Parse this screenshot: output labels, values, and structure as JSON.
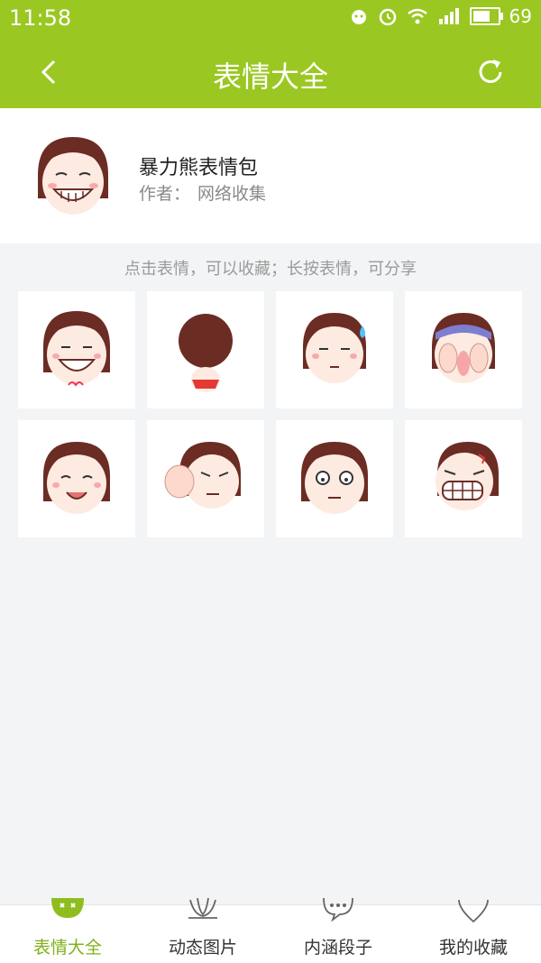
{
  "status_bar": {
    "time": "11:58",
    "battery": "69",
    "battery_level": 0.69
  },
  "app_bar": {
    "title": "表情大全",
    "back_icon": "back-arrow-icon",
    "refresh_icon": "refresh-icon"
  },
  "pack": {
    "name": "暴力熊表情包",
    "author_label": "作者：",
    "author": "网络收集"
  },
  "hint": "点击表情，可以收藏；长按表情，可分享",
  "stickers": [
    {
      "name": "sticker-grin"
    },
    {
      "name": "sticker-back-view"
    },
    {
      "name": "sticker-sweat"
    },
    {
      "name": "sticker-face-palm"
    },
    {
      "name": "sticker-smile"
    },
    {
      "name": "sticker-punch"
    },
    {
      "name": "sticker-dazed"
    },
    {
      "name": "sticker-angry-teeth"
    }
  ],
  "bottom_nav": [
    {
      "label": "表情大全",
      "icon": "emoji-face-icon",
      "active": true
    },
    {
      "label": "动态图片",
      "icon": "lotus-icon",
      "active": false
    },
    {
      "label": "内涵段子",
      "icon": "chat-bubble-icon",
      "active": false
    },
    {
      "label": "我的收藏",
      "icon": "heart-icon",
      "active": false
    }
  ],
  "colors": {
    "primary": "#9bc722",
    "nav_active": "#7fb11a",
    "background": "#f3f4f6"
  }
}
